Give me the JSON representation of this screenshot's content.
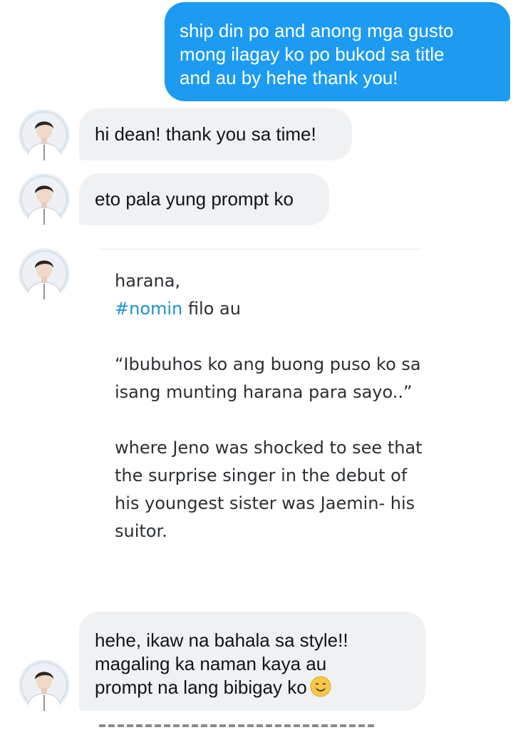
{
  "messages": {
    "sent_1": {
      "lines": [
        "ship din po and anong mga gusto",
        "mong ilagay ko po bukod sa title",
        "and au by hehe thank you!"
      ]
    },
    "received_1": {
      "text": "hi dean! thank you sa time!"
    },
    "received_2": {
      "text": "eto pala yung prompt ko"
    },
    "shared_image": {
      "line1": "harana,",
      "hashtag": "#nomin",
      "line2_rest": " filo au",
      "quote_lines": [
        "“Ibubuhos ko ang buong puso ko sa",
        "isang munting harana para sayo..”"
      ],
      "body_lines": [
        "where Jeno was shocked to see that",
        "the surprise singer in the debut of",
        "his youngest sister was Jaemin- his",
        "suitor."
      ]
    },
    "received_3": {
      "lines": [
        "hehe, ikaw na bahala sa style!!",
        "magaling ka naman kaya au",
        "prompt na lang bibigay ko"
      ],
      "emoji": "relieved-smiling-face-emoji"
    }
  },
  "colors": {
    "sent_bubble": "#1d9bf0",
    "received_bubble": "#eff1f3",
    "hashtag": "#1d93c7"
  },
  "icons": {
    "avatar": "user-avatar-photo"
  }
}
